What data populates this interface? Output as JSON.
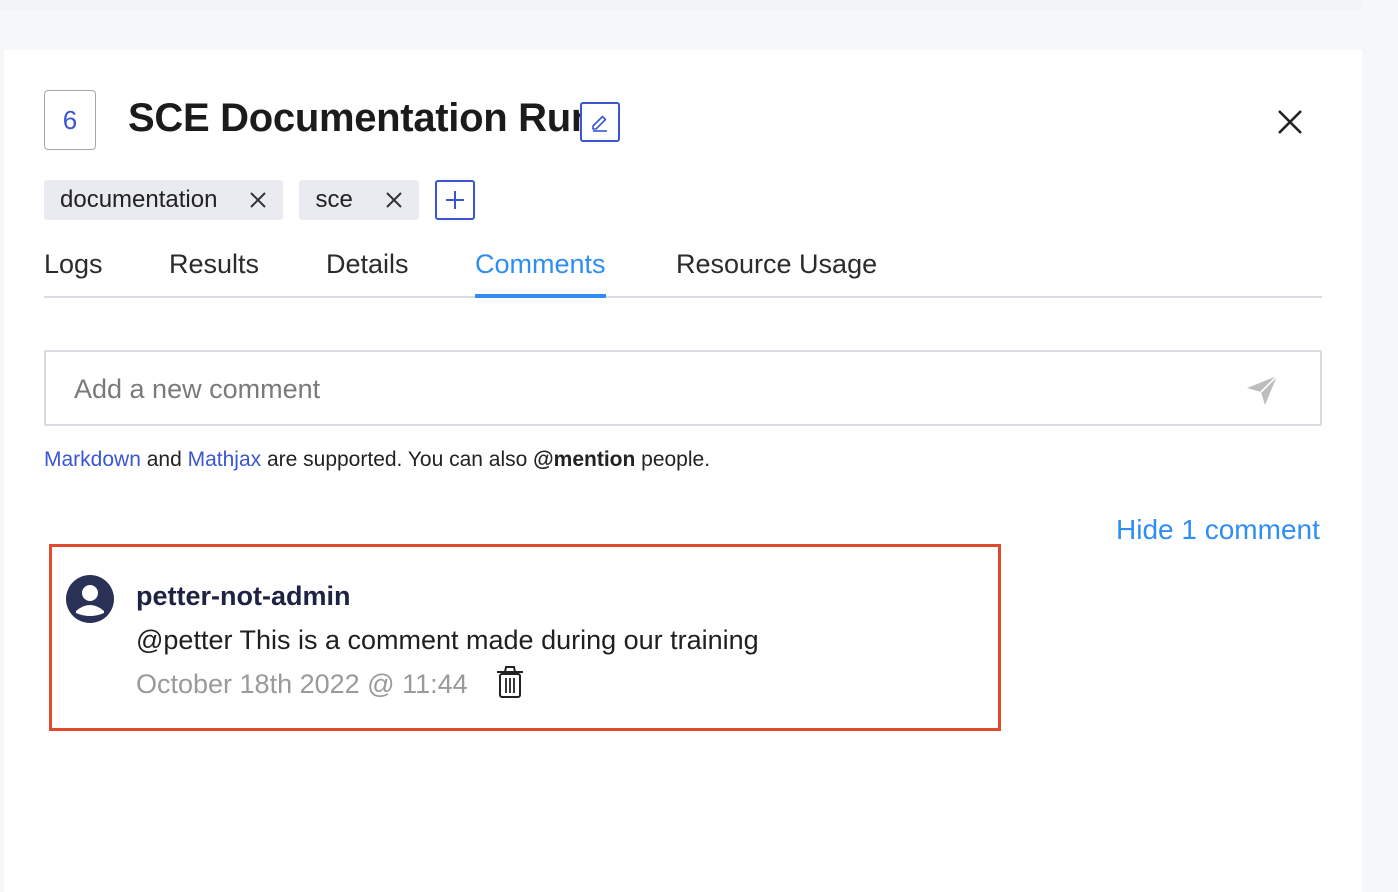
{
  "run": {
    "number": "6",
    "title": "SCE Documentation Run"
  },
  "tags": [
    {
      "label": "documentation"
    },
    {
      "label": "sce"
    }
  ],
  "tabs": [
    {
      "label": "Logs",
      "active": false
    },
    {
      "label": "Results",
      "active": false
    },
    {
      "label": "Details",
      "active": false
    },
    {
      "label": "Comments",
      "active": true
    },
    {
      "label": "Resource Usage",
      "active": false
    }
  ],
  "comment_form": {
    "placeholder": "Add a new comment",
    "value": ""
  },
  "hint": {
    "markdown_link": "Markdown",
    "and_text": " and ",
    "mathjax_link": "Mathjax",
    "supported_text": " are supported. You can also ",
    "mention_text": "@mention",
    "people_text": " people."
  },
  "toggle_comments_label": "Hide 1 comment",
  "comments": [
    {
      "author": "petter-not-admin",
      "text": "@petter This is a comment made during our training",
      "timestamp": "October 18th 2022 @ 11:44"
    }
  ],
  "colors": {
    "accent": "#2f8ef5",
    "primary": "#3a56d4",
    "highlight_border": "#e04a2f",
    "author": "#1e2344"
  }
}
